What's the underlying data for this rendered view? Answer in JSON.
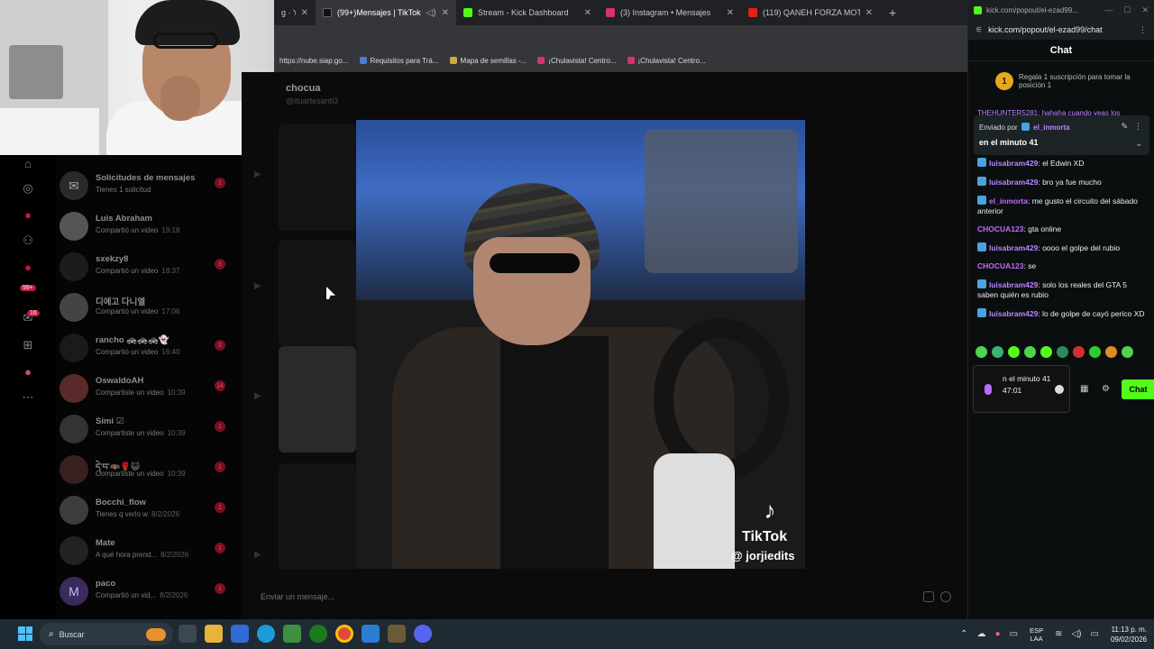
{
  "browser": {
    "tabs": [
      {
        "label": "g · Y",
        "active": false
      },
      {
        "label": "(99+)Mensajes | TikTok",
        "active": true
      },
      {
        "label": "Stream - Kick Dashboard",
        "active": false
      },
      {
        "label": "(3) Instagram • Mensajes",
        "active": false
      },
      {
        "label": "(119) QANEH FORZA MOTORSP",
        "active": false
      }
    ],
    "new_tab": "+",
    "bookmarks": [
      "https://nube.siap.go...",
      "Requisitos para Trá...",
      "Mapa de semillas -...",
      "¡Chulavista! Centro...",
      "¡Chulavista! Centro..."
    ]
  },
  "nav": {
    "badge": "99+",
    "badge2": "16"
  },
  "messages": [
    {
      "name": "Solicitudes de mensajes",
      "sub": "Tienes 1 solicitud",
      "time": "",
      "badge": "1",
      "avatar": "✉"
    },
    {
      "name": "Luis Abraham",
      "sub": "Compartió un video",
      "time": "19:18",
      "badge": "",
      "avatar": ""
    },
    {
      "name": "sxekzy8",
      "sub": "Compartió un video",
      "time": "18:37",
      "badge": "3",
      "avatar": ""
    },
    {
      "name": "디에고 다니엘",
      "sub": "Compartió un video",
      "time": "17:06",
      "badge": "",
      "avatar": ""
    },
    {
      "name": "rancho 🚓🚓🚓👻",
      "sub": "Compartió un video",
      "time": "16:40",
      "badge": "3",
      "avatar": ""
    },
    {
      "name": "OswaldoAH",
      "sub": "Compartiste un video",
      "time": "10:39",
      "badge": "14",
      "avatar": ""
    },
    {
      "name": "Simi ☑",
      "sub": "Compartiste un video",
      "time": "10:39",
      "badge": "1",
      "avatar": ""
    },
    {
      "name": "དེ་བ་🦇🌹😺",
      "sub": "Compartiste un video",
      "time": "10:39",
      "badge": "1",
      "avatar": ""
    },
    {
      "name": "Bocchi_flow",
      "sub": "Tienes q verlo w",
      "time": "8/2/2026",
      "badge": "2",
      "avatar": ""
    },
    {
      "name": "Mate",
      "sub": "A qué hora prend...",
      "time": "8/2/2026",
      "badge": "1",
      "avatar": ""
    },
    {
      "name": "paco",
      "sub": "Compartió un vid...",
      "time": "8/2/2026",
      "badge": "1",
      "avatar": "M"
    }
  ],
  "conversation": {
    "name": "chocua",
    "handle": "@ituartesanti3",
    "input_placeholder": "Enviar un mensaje..."
  },
  "video": {
    "brand": "TikTok",
    "user": "@ jorjiedits"
  },
  "kick": {
    "window_title": "kick.com/popout/el-ezad99...",
    "url": "kick.com/popout/el-ezad99/chat",
    "header": "Chat",
    "gift_rank": "1",
    "gift_text": "Regala 1 suscripción para tomar la posición 1",
    "hidden_line": "THEHUNTER5281: hahaha cuando veas los",
    "pinned_by": "Enviado por",
    "pinned_user": "el_inmorta",
    "pinned_text": "en el minuto 41",
    "chat": [
      {
        "user": "luisabram429",
        "text": ": el Edwin XD",
        "badge": true,
        "color": "purple"
      },
      {
        "user": "luisabram429",
        "text": ": bro ya fue mucho",
        "badge": true,
        "color": "purple"
      },
      {
        "user": "el_inmorta",
        "text": ": me gusto el circuito del sábado anterior",
        "badge": true,
        "color": "violet"
      },
      {
        "user": "CHOCUA123",
        "text": ": gta online",
        "badge": false,
        "color": "violet"
      },
      {
        "user": "luisabram429",
        "text": ": oooo el golpe del rubio",
        "badge": true,
        "color": "purple"
      },
      {
        "user": "CHOCUA123",
        "text": ": se",
        "badge": false,
        "color": "violet"
      },
      {
        "user": "luisabram429",
        "text": ": solo los reales del GTA 5 saben quién es rubio",
        "badge": true,
        "color": "purple"
      },
      {
        "user": "luisabram429",
        "text": ": lo de golpe de cayó perico XD",
        "badge": true,
        "color": "purple"
      }
    ],
    "input_value": "n el minuto 41 47:01",
    "chat_button": "Chat"
  },
  "taskbar": {
    "search": "Buscar",
    "lang_top": "ESP",
    "lang_bottom": "LAA",
    "time": "11:13 p. m.",
    "date": "09/02/2026"
  }
}
